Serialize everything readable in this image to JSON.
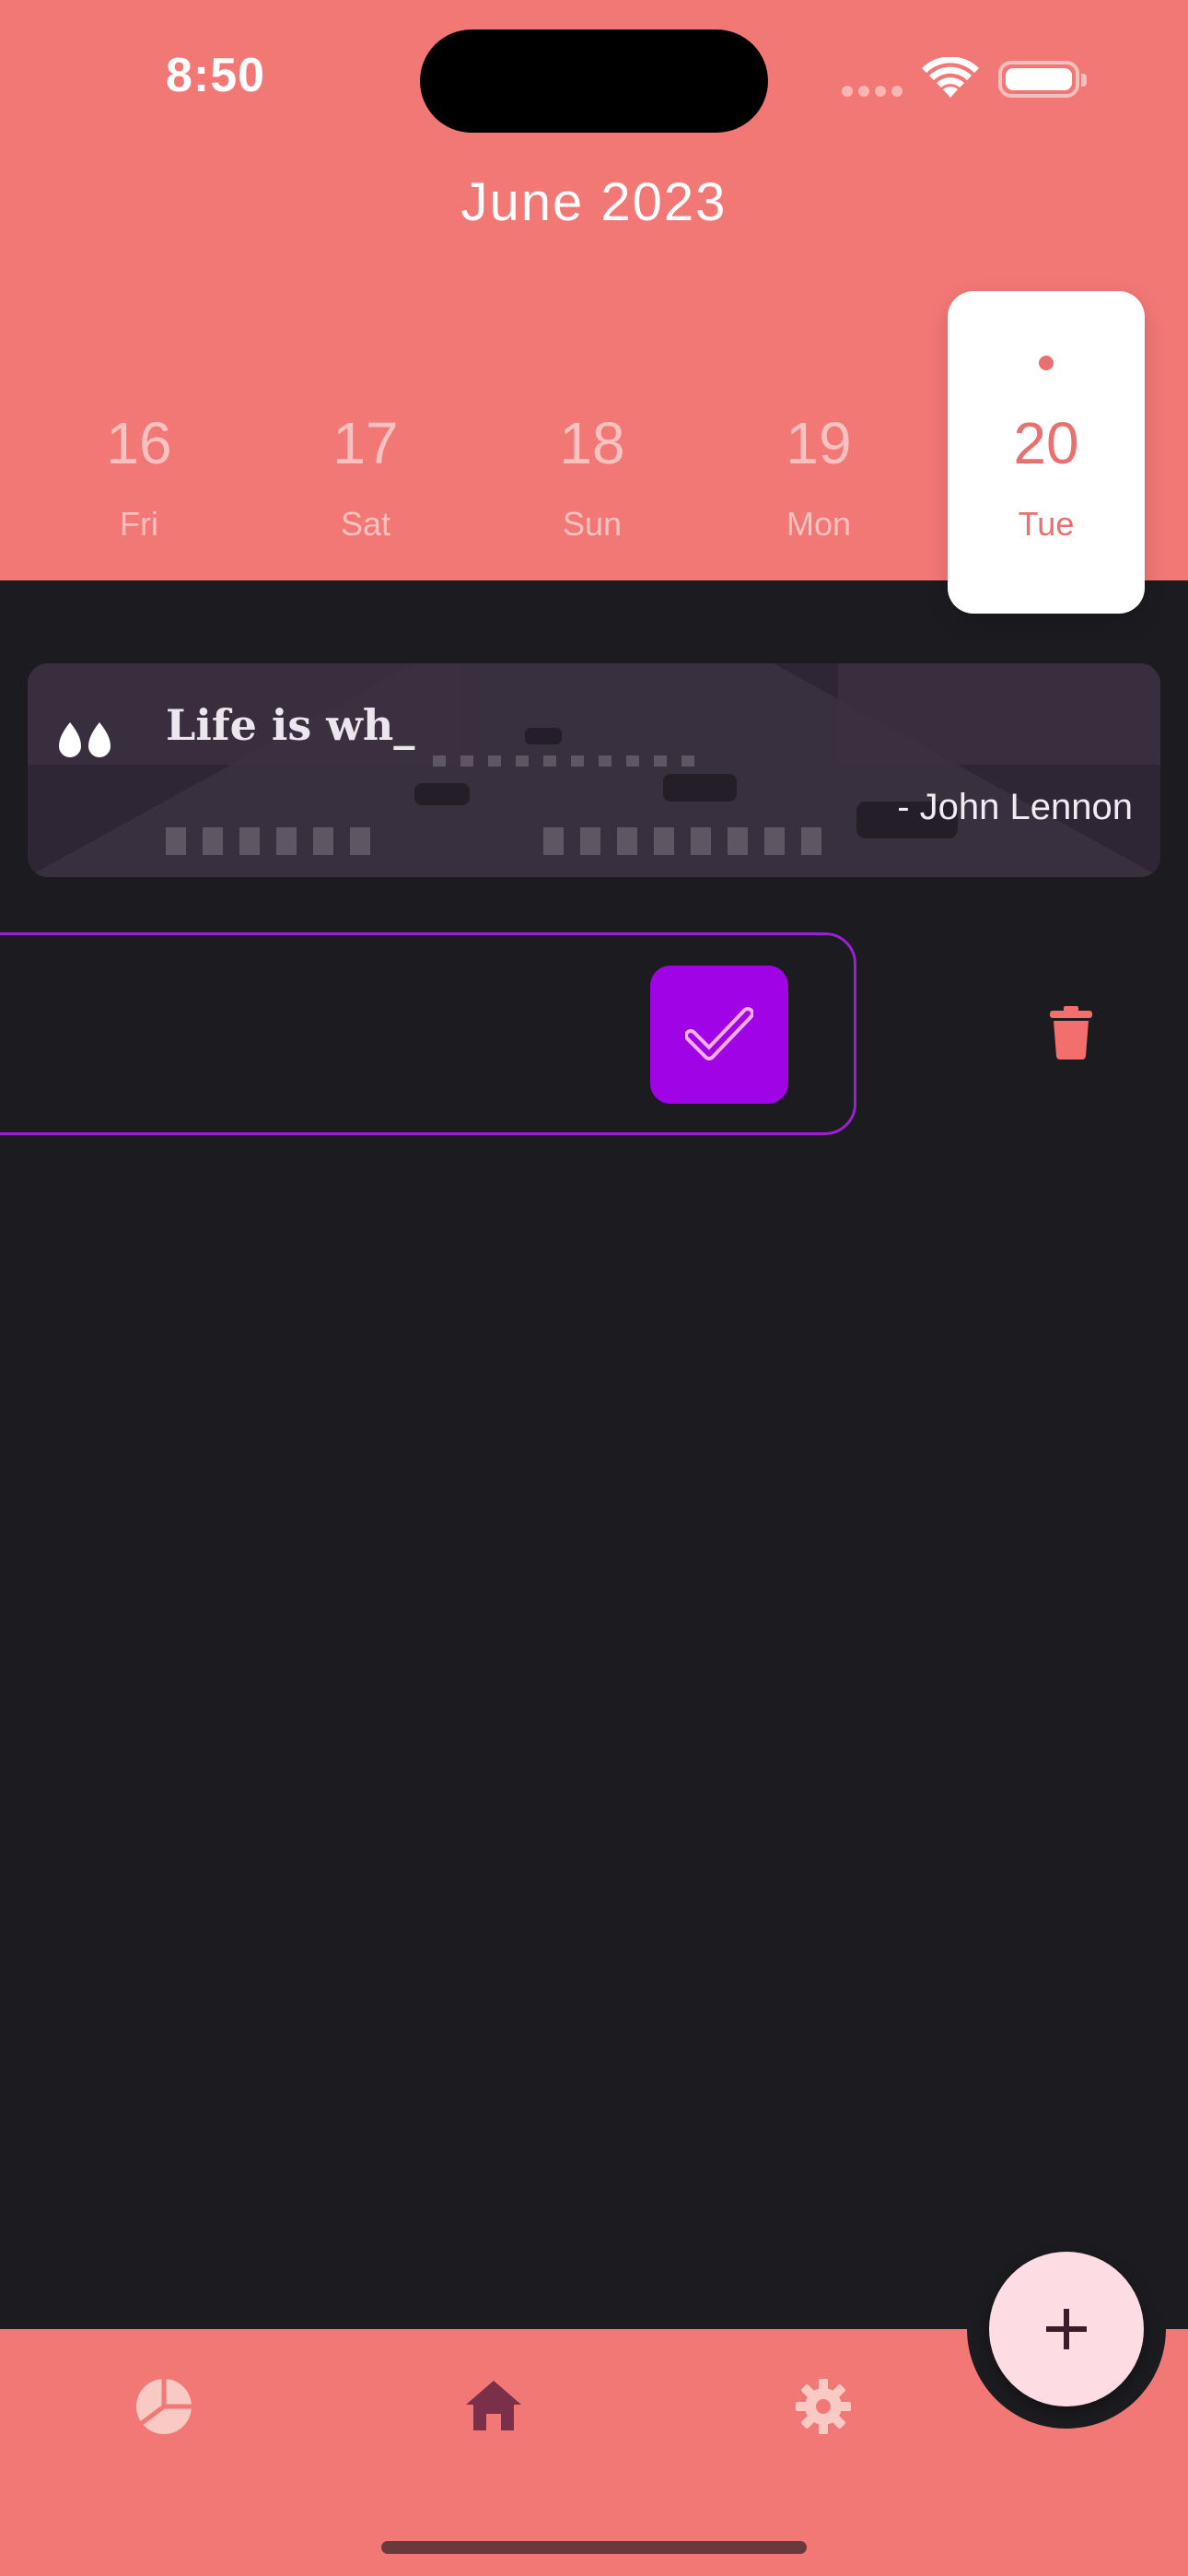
{
  "status_bar": {
    "time": "8:50"
  },
  "calendar": {
    "month_label": "June 2023",
    "days": [
      {
        "num": "16",
        "weekday": "Fri"
      },
      {
        "num": "17",
        "weekday": "Sat"
      },
      {
        "num": "18",
        "weekday": "Sun"
      },
      {
        "num": "19",
        "weekday": "Mon"
      },
      {
        "num": "20",
        "weekday": "Tue",
        "selected": true
      }
    ]
  },
  "quote": {
    "text": "Life is wh_",
    "author": "- John Lennon"
  },
  "colors": {
    "accent": "#f27876",
    "background": "#1c1c20",
    "task_border": "#9a1fd6",
    "check_button": "#a004e6",
    "delete": "#f26f6d",
    "fab": "#fedce4"
  },
  "icons": {
    "quote": "quote-icon",
    "check": "check-icon",
    "delete": "trash-icon",
    "add": "plus-icon",
    "nav": [
      "pie-chart-icon",
      "home-icon",
      "gear-icon"
    ]
  }
}
